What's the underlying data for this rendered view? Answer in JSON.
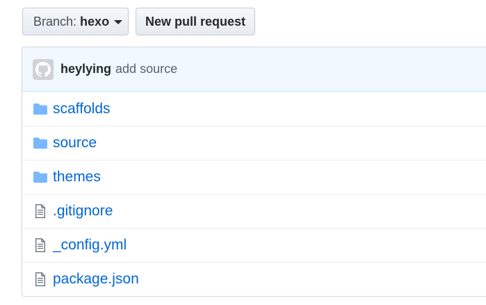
{
  "toolbar": {
    "branch_prefix": "Branch:",
    "branch_name": "hexo",
    "new_pr_label": "New pull request"
  },
  "commit": {
    "author": "heylying",
    "message": "add source"
  },
  "files": [
    {
      "name": "scaffolds",
      "type": "folder",
      "icon": "folder-icon"
    },
    {
      "name": "source",
      "type": "folder",
      "icon": "folder-icon"
    },
    {
      "name": "themes",
      "type": "folder",
      "icon": "folder-icon"
    },
    {
      "name": ".gitignore",
      "type": "file",
      "icon": "file-text-icon"
    },
    {
      "name": "_config.yml",
      "type": "file",
      "icon": "file-text-icon"
    },
    {
      "name": "package.json",
      "type": "file",
      "icon": "file-text-icon"
    }
  ],
  "colors": {
    "link": "#0366d6",
    "folder_icon": "#79b8ff",
    "commit_bar_bg": "#f1f8ff"
  }
}
